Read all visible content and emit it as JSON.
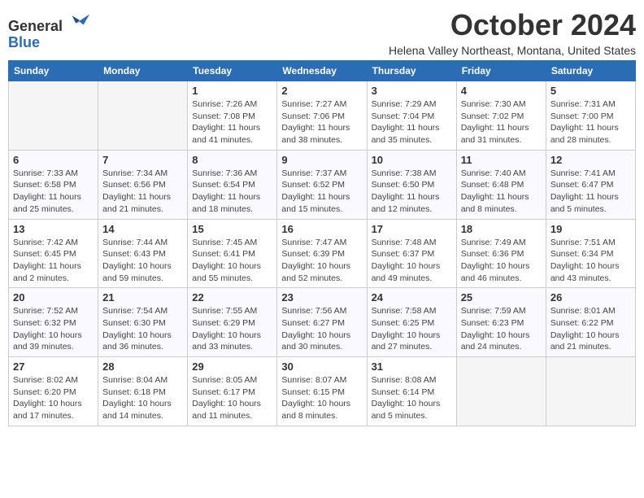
{
  "header": {
    "logo_line1": "General",
    "logo_line2": "Blue",
    "month_title": "October 2024",
    "location": "Helena Valley Northeast, Montana, United States"
  },
  "days_of_week": [
    "Sunday",
    "Monday",
    "Tuesday",
    "Wednesday",
    "Thursday",
    "Friday",
    "Saturday"
  ],
  "weeks": [
    [
      {
        "day": "",
        "info": ""
      },
      {
        "day": "",
        "info": ""
      },
      {
        "day": "1",
        "info": "Sunrise: 7:26 AM\nSunset: 7:08 PM\nDaylight: 11 hours and 41 minutes."
      },
      {
        "day": "2",
        "info": "Sunrise: 7:27 AM\nSunset: 7:06 PM\nDaylight: 11 hours and 38 minutes."
      },
      {
        "day": "3",
        "info": "Sunrise: 7:29 AM\nSunset: 7:04 PM\nDaylight: 11 hours and 35 minutes."
      },
      {
        "day": "4",
        "info": "Sunrise: 7:30 AM\nSunset: 7:02 PM\nDaylight: 11 hours and 31 minutes."
      },
      {
        "day": "5",
        "info": "Sunrise: 7:31 AM\nSunset: 7:00 PM\nDaylight: 11 hours and 28 minutes."
      }
    ],
    [
      {
        "day": "6",
        "info": "Sunrise: 7:33 AM\nSunset: 6:58 PM\nDaylight: 11 hours and 25 minutes."
      },
      {
        "day": "7",
        "info": "Sunrise: 7:34 AM\nSunset: 6:56 PM\nDaylight: 11 hours and 21 minutes."
      },
      {
        "day": "8",
        "info": "Sunrise: 7:36 AM\nSunset: 6:54 PM\nDaylight: 11 hours and 18 minutes."
      },
      {
        "day": "9",
        "info": "Sunrise: 7:37 AM\nSunset: 6:52 PM\nDaylight: 11 hours and 15 minutes."
      },
      {
        "day": "10",
        "info": "Sunrise: 7:38 AM\nSunset: 6:50 PM\nDaylight: 11 hours and 12 minutes."
      },
      {
        "day": "11",
        "info": "Sunrise: 7:40 AM\nSunset: 6:48 PM\nDaylight: 11 hours and 8 minutes."
      },
      {
        "day": "12",
        "info": "Sunrise: 7:41 AM\nSunset: 6:47 PM\nDaylight: 11 hours and 5 minutes."
      }
    ],
    [
      {
        "day": "13",
        "info": "Sunrise: 7:42 AM\nSunset: 6:45 PM\nDaylight: 11 hours and 2 minutes."
      },
      {
        "day": "14",
        "info": "Sunrise: 7:44 AM\nSunset: 6:43 PM\nDaylight: 10 hours and 59 minutes."
      },
      {
        "day": "15",
        "info": "Sunrise: 7:45 AM\nSunset: 6:41 PM\nDaylight: 10 hours and 55 minutes."
      },
      {
        "day": "16",
        "info": "Sunrise: 7:47 AM\nSunset: 6:39 PM\nDaylight: 10 hours and 52 minutes."
      },
      {
        "day": "17",
        "info": "Sunrise: 7:48 AM\nSunset: 6:37 PM\nDaylight: 10 hours and 49 minutes."
      },
      {
        "day": "18",
        "info": "Sunrise: 7:49 AM\nSunset: 6:36 PM\nDaylight: 10 hours and 46 minutes."
      },
      {
        "day": "19",
        "info": "Sunrise: 7:51 AM\nSunset: 6:34 PM\nDaylight: 10 hours and 43 minutes."
      }
    ],
    [
      {
        "day": "20",
        "info": "Sunrise: 7:52 AM\nSunset: 6:32 PM\nDaylight: 10 hours and 39 minutes."
      },
      {
        "day": "21",
        "info": "Sunrise: 7:54 AM\nSunset: 6:30 PM\nDaylight: 10 hours and 36 minutes."
      },
      {
        "day": "22",
        "info": "Sunrise: 7:55 AM\nSunset: 6:29 PM\nDaylight: 10 hours and 33 minutes."
      },
      {
        "day": "23",
        "info": "Sunrise: 7:56 AM\nSunset: 6:27 PM\nDaylight: 10 hours and 30 minutes."
      },
      {
        "day": "24",
        "info": "Sunrise: 7:58 AM\nSunset: 6:25 PM\nDaylight: 10 hours and 27 minutes."
      },
      {
        "day": "25",
        "info": "Sunrise: 7:59 AM\nSunset: 6:23 PM\nDaylight: 10 hours and 24 minutes."
      },
      {
        "day": "26",
        "info": "Sunrise: 8:01 AM\nSunset: 6:22 PM\nDaylight: 10 hours and 21 minutes."
      }
    ],
    [
      {
        "day": "27",
        "info": "Sunrise: 8:02 AM\nSunset: 6:20 PM\nDaylight: 10 hours and 17 minutes."
      },
      {
        "day": "28",
        "info": "Sunrise: 8:04 AM\nSunset: 6:18 PM\nDaylight: 10 hours and 14 minutes."
      },
      {
        "day": "29",
        "info": "Sunrise: 8:05 AM\nSunset: 6:17 PM\nDaylight: 10 hours and 11 minutes."
      },
      {
        "day": "30",
        "info": "Sunrise: 8:07 AM\nSunset: 6:15 PM\nDaylight: 10 hours and 8 minutes."
      },
      {
        "day": "31",
        "info": "Sunrise: 8:08 AM\nSunset: 6:14 PM\nDaylight: 10 hours and 5 minutes."
      },
      {
        "day": "",
        "info": ""
      },
      {
        "day": "",
        "info": ""
      }
    ]
  ]
}
